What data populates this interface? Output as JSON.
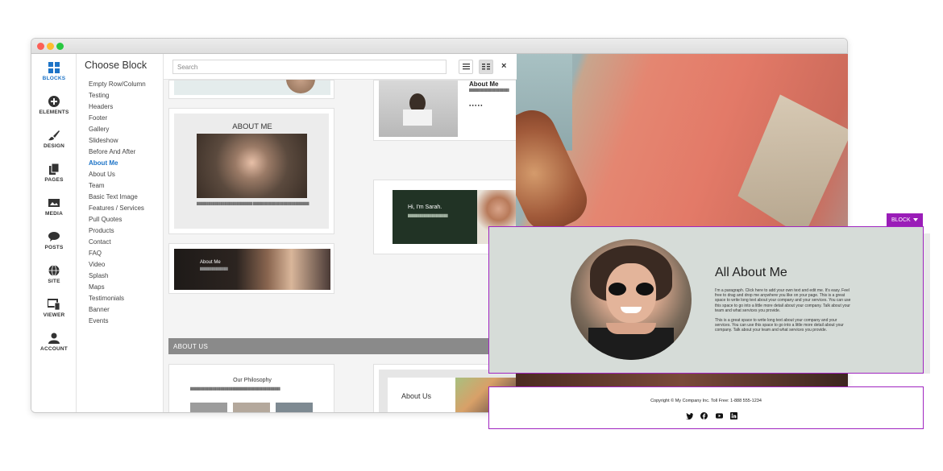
{
  "rail": [
    {
      "label": "BLOCKS",
      "icon": "blocks-icon",
      "active": true
    },
    {
      "label": "ELEMENTS",
      "icon": "plus-circle-icon"
    },
    {
      "label": "DESIGN",
      "icon": "brush-icon"
    },
    {
      "label": "PAGES",
      "icon": "pages-icon"
    },
    {
      "label": "MEDIA",
      "icon": "image-icon"
    },
    {
      "label": "POSTS",
      "icon": "chat-bubble-icon"
    },
    {
      "label": "SITE",
      "icon": "globe-icon"
    },
    {
      "label": "VIEWER",
      "icon": "devices-icon"
    },
    {
      "label": "ACCOUNT",
      "icon": "user-icon"
    }
  ],
  "panel": {
    "title": "Choose Block",
    "categories": [
      "Empty Row/Column",
      "Testing",
      "Headers",
      "Footer",
      "Gallery",
      "Slideshow",
      "Before And After",
      "About Me",
      "About Us",
      "Team",
      "Basic Text Image",
      "Features / Services",
      "Pull Quotes",
      "Products",
      "Contact",
      "FAQ",
      "Video",
      "Splash",
      "Maps",
      "Testimonials",
      "Banner",
      "Events"
    ],
    "active_category": "About Me"
  },
  "search": {
    "placeholder": "Search",
    "value": ""
  },
  "close_label": "×",
  "thumbs": {
    "about_me_1": "ABOUT ME",
    "about_me_2": "About Me",
    "hi_sarah": "Hi, I'm Sarah.",
    "about_me_3": "About Me",
    "section_about_us": "ABOUT US",
    "philosophy": "Our Philosophy",
    "about_us": "About Us"
  },
  "block_tag": "BLOCK",
  "about_block": {
    "title": "All About Me",
    "p1": "I'm a paragraph. Click here to add your own text and edit me. It's easy. Feel free to drag and drop me anywhere you like on your page.  This is a great space to write long text about your company and your services. You can use this space to go into a little more detail about your company. Talk about your team and what services you provide.",
    "p2": "This is a great space to write long text about your company and your services. You can use this space to go into a little more detail about your company. Talk about your team and what services you provide."
  },
  "footer_block": {
    "copyright": "Copyright © My Company Inc.   Toll Free: 1-888 555-1234",
    "socials": [
      "twitter-icon",
      "facebook-icon",
      "youtube-icon",
      "linkedin-icon"
    ]
  },
  "colors": {
    "accent": "#1e74c7",
    "selection": "#a025c0",
    "section_bar": "#8a8a8a"
  }
}
